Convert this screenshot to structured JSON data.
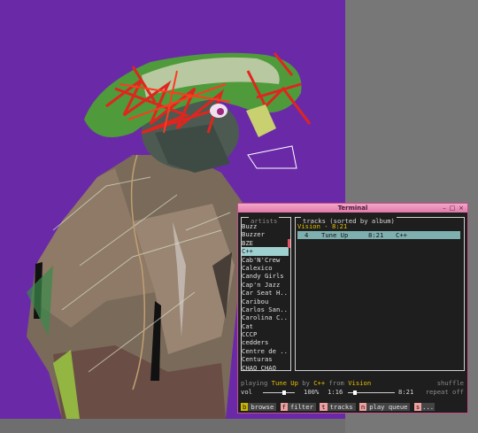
{
  "window": {
    "title": "Terminal",
    "buttons": [
      "–",
      "□",
      "×"
    ]
  },
  "artists_panel": {
    "title": "artists",
    "items": [
      "Buzz",
      "Buzzer",
      "BZE",
      "C++",
      "Cab'N'Crew",
      "Calexico",
      "Candy Girls",
      "Cap'n Jazz",
      "Car Seat H..",
      "Caribou",
      "Carlos San..",
      "Carolina C..",
      "Cat",
      "CCCP",
      "cedders",
      "Centre de ..",
      "Centuras",
      "CHAO CHAO"
    ],
    "selected": "C++"
  },
  "tracks_panel": {
    "title": "tracks (sorted by album)",
    "album_header": "Vision - 8:21",
    "rows": [
      {
        "num": "4",
        "title": "Tune Up",
        "time": "8:21",
        "artist": "C++"
      }
    ]
  },
  "status": {
    "playing_prefix": "playing",
    "track": "Tune Up",
    "by": "by",
    "artist": "C++",
    "from": "from",
    "album": "Vision",
    "shuffle": "shuffle",
    "vol_label": "vol",
    "volume": "100%",
    "elapsed": "1:16",
    "total": "8:21",
    "repeat": "repeat off",
    "progress": 0.15
  },
  "keys": [
    {
      "key": "b",
      "label": "browse"
    },
    {
      "key": "f",
      "label": "filter"
    },
    {
      "key": "t",
      "label": "tracks"
    },
    {
      "key": "n",
      "label": "play queue"
    },
    {
      "key": "s",
      "label": "..."
    }
  ]
}
